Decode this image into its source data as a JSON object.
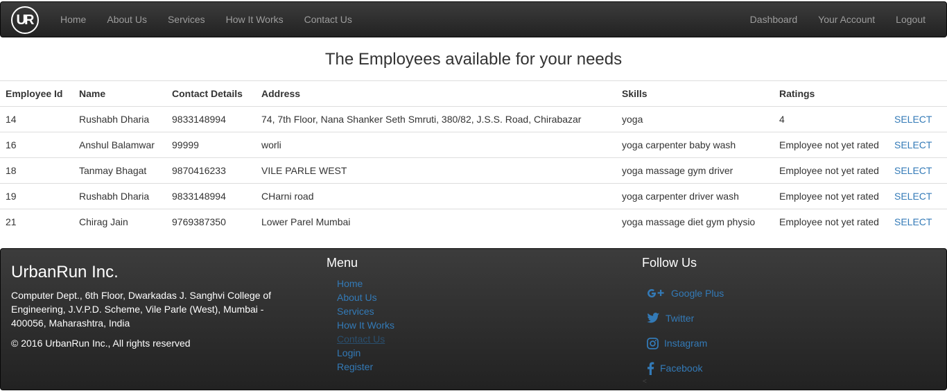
{
  "nav": {
    "logo_text": "UR",
    "left": [
      "Home",
      "About Us",
      "Services",
      "How It Works",
      "Contact Us"
    ],
    "right": [
      "Dashboard",
      "Your Account",
      "Logout"
    ]
  },
  "title": "The Employees available for your needs",
  "table": {
    "headers": [
      "Employee Id",
      "Name",
      "Contact Details",
      "Address",
      "Skills",
      "Ratings"
    ],
    "select_label": "SELECT",
    "rows": [
      [
        "14",
        "Rushabh Dharia",
        "9833148994",
        "74, 7th Floor, Nana Shanker Seth Smruti, 380/82, J.S.S. Road, Chirabazar",
        "yoga",
        "4"
      ],
      [
        "16",
        "Anshul Balamwar",
        "99999",
        "worli",
        "yoga carpenter baby wash",
        "Employee not yet rated"
      ],
      [
        "18",
        "Tanmay Bhagat",
        "9870416233",
        "VILE PARLE WEST",
        "yoga massage gym driver",
        "Employee not yet rated"
      ],
      [
        "19",
        "Rushabh Dharia",
        "9833148994",
        "CHarni road",
        "yoga carpenter driver wash",
        "Employee not yet rated"
      ],
      [
        "21",
        "Chirag Jain",
        "9769387350",
        "Lower Parel Mumbai",
        "yoga massage diet gym physio",
        "Employee not yet rated"
      ]
    ]
  },
  "footer": {
    "brand": "UrbanRun Inc.",
    "address": "Computer Dept., 6th Floor, Dwarkadas J. Sanghvi College of Engineering, J.V.P.D. Scheme, Vile Parle (West), Mumbai - 400056, Maharashtra, India",
    "copyright": "© 2016 UrbanRun Inc., All rights reserved",
    "menu_title": "Menu",
    "menu": [
      "Home",
      "About Us",
      "Services",
      "How It Works",
      "Contact Us",
      "Login",
      "Register"
    ],
    "follow_title": "Follow Us",
    "social": [
      {
        "label": "Google Plus",
        "icon": "google-plus-icon"
      },
      {
        "label": "Twitter",
        "icon": "twitter-icon"
      },
      {
        "label": "Instagram",
        "icon": "instagram-icon"
      },
      {
        "label": "Facebook",
        "icon": "facebook-icon"
      }
    ]
  },
  "colors": {
    "navbar": "#222222",
    "nav_link": "#9d9d9d",
    "link": "#337ab7"
  }
}
